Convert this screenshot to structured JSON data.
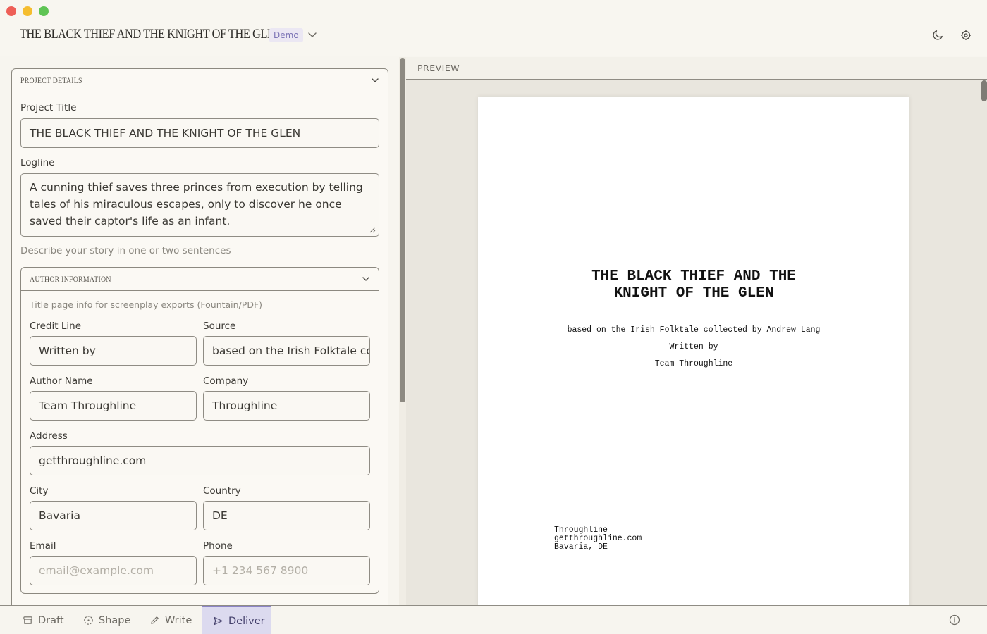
{
  "app": {
    "title": "THE BLACK THIEF AND THE KNIGHT OF THE GLEN",
    "badge": "Demo"
  },
  "project_details": {
    "section_title": "PROJECT DETAILS",
    "project_title_label": "Project Title",
    "project_title_value": "THE BLACK THIEF AND THE KNIGHT OF THE GLEN",
    "logline_label": "Logline",
    "logline_value": "A cunning thief saves three princes from execution by telling tales of his miraculous escapes, only to discover he once saved their captor's life as an infant.",
    "logline_help": "Describe your story in one or two sentences"
  },
  "author_information": {
    "section_title": "AUTHOR INFORMATION",
    "help": "Title page info for screenplay exports (Fountain/PDF)",
    "credit_line_label": "Credit Line",
    "credit_line_value": "Written by",
    "source_label": "Source",
    "source_value": "based on the Irish Folktale collected by Andrew Lang",
    "author_name_label": "Author Name",
    "author_name_value": "Team Throughline",
    "company_label": "Company",
    "company_value": "Throughline",
    "address_label": "Address",
    "address_value": "getthroughline.com",
    "city_label": "City",
    "city_value": "Bavaria",
    "country_label": "Country",
    "country_value": "DE",
    "email_label": "Email",
    "email_placeholder": "email@example.com",
    "phone_label": "Phone",
    "phone_placeholder": "+1 234 567 8900"
  },
  "preview": {
    "label": "PREVIEW",
    "title_line1": "THE BLACK THIEF AND THE",
    "title_line2": "KNIGHT OF THE GLEN",
    "source_line": "based on the Irish Folktale collected by Andrew Lang",
    "credit_line": "Written by",
    "author_line": "Team Throughline",
    "contact_company": "Throughline",
    "contact_address": "getthroughline.com",
    "contact_location": "Bavaria, DE"
  },
  "bottom_tabs": [
    {
      "label": "Draft",
      "icon": "archive-icon",
      "active": false
    },
    {
      "label": "Shape",
      "icon": "dashed-circle-icon",
      "active": false
    },
    {
      "label": "Write",
      "icon": "pencil-icon",
      "active": false
    },
    {
      "label": "Deliver",
      "icon": "send-icon",
      "active": true
    }
  ],
  "colors": {
    "background": "#f7f5ef",
    "accent": "#8b84c6",
    "active_tab_bg": "#dcdaef",
    "badge_bg": "#ebe7f3",
    "badge_text": "#7b73b5"
  }
}
